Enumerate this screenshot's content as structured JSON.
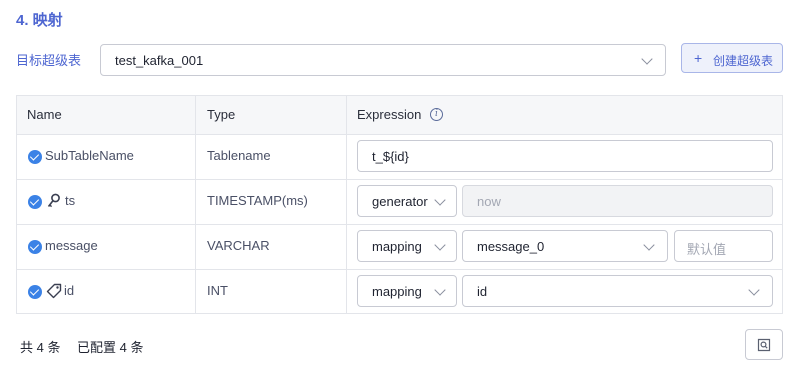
{
  "section": {
    "title": "4. 映射"
  },
  "target_table": {
    "label": "目标超级表",
    "selected": "test_kafka_001",
    "create_button": "创建超级表"
  },
  "table": {
    "headers": {
      "name": "Name",
      "type": "Type",
      "expression": "Expression"
    },
    "rows": [
      {
        "name": "SubTableName",
        "type": "Tablename",
        "expression_value": "t_${id}"
      },
      {
        "name": "ts",
        "type": "TIMESTAMP(ms)",
        "mode": "generator",
        "value": "now"
      },
      {
        "name": "message",
        "type": "VARCHAR",
        "mode": "mapping",
        "value": "message_0",
        "default_placeholder": "默认值"
      },
      {
        "name": "id",
        "type": "INT",
        "mode": "mapping",
        "value": "id"
      }
    ]
  },
  "footer": {
    "total": "共 4 条",
    "configured": "已配置 4 条"
  },
  "colors": {
    "accent": "#4e66d1",
    "check": "#3b82e6"
  },
  "icons": [
    "chevron-down-icon",
    "plus-icon",
    "info-icon",
    "check-circle-icon",
    "key-icon",
    "tag-icon",
    "search-view-icon"
  ]
}
